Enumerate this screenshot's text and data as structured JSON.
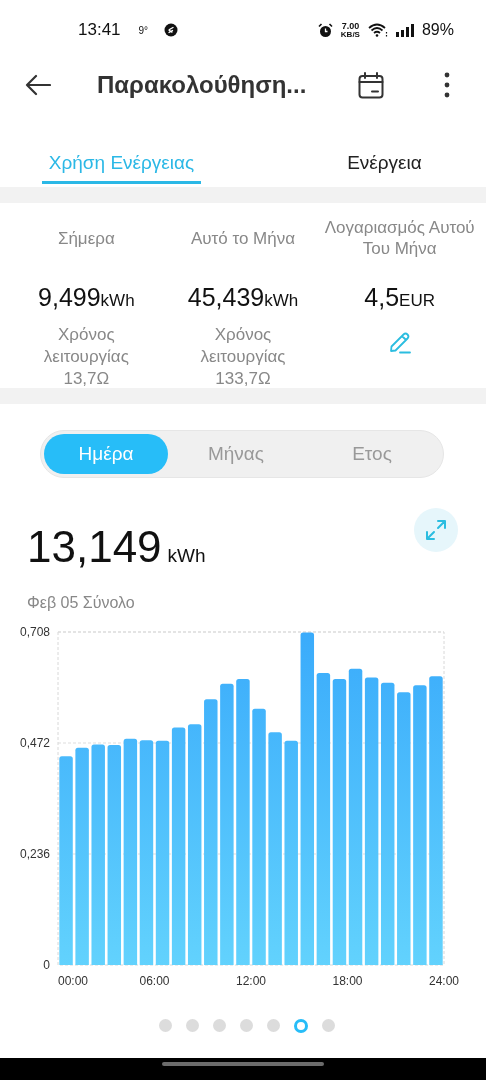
{
  "status_bar": {
    "time": "13:41",
    "temperature": "9°",
    "speed_value": "7.00",
    "speed_unit": "KB/S",
    "battery": "89%"
  },
  "app_bar": {
    "title": "Παρακολούθηση..."
  },
  "tabs": [
    {
      "label": "Χρήση Ενέργειας",
      "selected": true
    },
    {
      "label": "Ενέργεια",
      "selected": false
    }
  ],
  "stats": [
    {
      "label": "Σήμερα",
      "value": "9,499",
      "unit": "kWh",
      "sub": "Χρόνος λειτουργίας 13,7Ω",
      "kind": "text"
    },
    {
      "label": "Αυτό το Μήνα",
      "value": "45,439",
      "unit": "kWh",
      "sub": "Χρόνος λειτουργίας 133,7Ω",
      "kind": "text"
    },
    {
      "label": "Λογαριασμός Αυτού Του Μήνα",
      "value": "4,5",
      "unit": "EUR",
      "kind": "edit"
    }
  ],
  "periods": [
    {
      "label": "Ημέρα",
      "selected": true
    },
    {
      "label": "Μήνας",
      "selected": false
    },
    {
      "label": "Ετος",
      "selected": false
    }
  ],
  "total": {
    "value": "13,149",
    "unit": "kWh",
    "caption": "Φεβ 05 Σύνολο"
  },
  "chart_data": {
    "type": "bar",
    "x": [
      0.5,
      1.5,
      2.5,
      3.5,
      4.5,
      5.5,
      6.5,
      7.5,
      8.5,
      9.5,
      10.5,
      11.5,
      12.5,
      13.5,
      14.5,
      15.5,
      16.5,
      17.5,
      18.5,
      19.5,
      20.5,
      21.5,
      22.5,
      23.5
    ],
    "xlim": [
      0,
      24
    ],
    "ylim": [
      0,
      0.708
    ],
    "yticks": [
      {
        "value": 0,
        "label": "0"
      },
      {
        "value": 0.236,
        "label": "0,236"
      },
      {
        "value": 0.472,
        "label": "0,472"
      },
      {
        "value": 0.708,
        "label": "0,708"
      }
    ],
    "xticks": [
      {
        "value": 0,
        "label": "00:00"
      },
      {
        "value": 6,
        "label": "06:00"
      },
      {
        "value": 12,
        "label": "12:00"
      },
      {
        "value": 18,
        "label": "18:00"
      },
      {
        "value": 24,
        "label": "24:00"
      }
    ],
    "series": [
      {
        "color": "#3aabfb",
        "values": [
          0.444,
          0.462,
          0.469,
          0.468,
          0.481,
          0.478,
          0.477,
          0.505,
          0.512,
          0.565,
          0.598,
          0.608,
          0.545,
          0.495,
          0.477,
          0.707,
          0.621,
          0.608,
          0.63,
          0.611,
          0.6,
          0.58,
          0.595,
          0.614
        ]
      }
    ]
  },
  "pages": [
    {
      "selected": false
    },
    {
      "selected": false
    },
    {
      "selected": false
    },
    {
      "selected": false
    },
    {
      "selected": false
    },
    {
      "selected": true
    },
    {
      "selected": false
    }
  ]
}
